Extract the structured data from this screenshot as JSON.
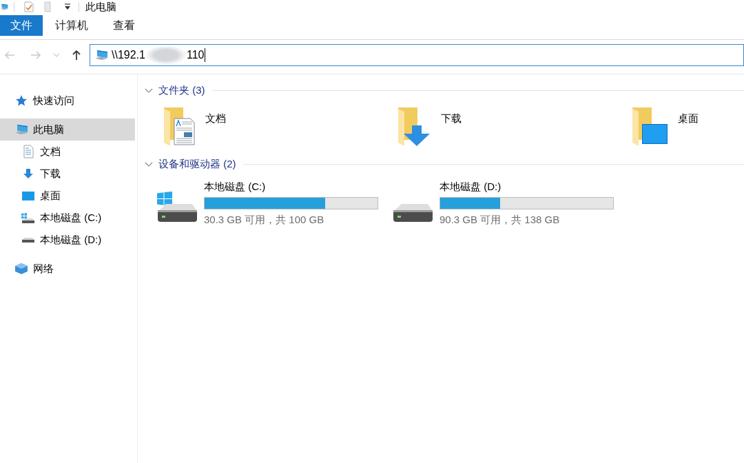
{
  "window": {
    "title": "此电脑"
  },
  "ribbon_tabs": [
    {
      "label": "文件",
      "kind": "file",
      "selected": false
    },
    {
      "label": "计算机",
      "kind": "tab",
      "selected": false
    },
    {
      "label": "查看",
      "kind": "tab",
      "selected": false
    }
  ],
  "nav_buttons": [
    {
      "kind": "back",
      "disabled": true
    },
    {
      "kind": "forward",
      "disabled": true
    },
    {
      "kind": "recent",
      "disabled": true
    },
    {
      "kind": "up",
      "disabled": false
    }
  ],
  "address": {
    "value_start": "\\\\192.1",
    "value_end": "110",
    "redacted": true,
    "focused": true
  },
  "sidebar": {
    "items": [
      {
        "label": "快速访问",
        "kind": "quick-access",
        "selected": false
      },
      {
        "label": "此电脑",
        "kind": "computer",
        "selected": true,
        "children": [
          {
            "label": "文档",
            "kind": "documents",
            "selected": false
          },
          {
            "label": "下载",
            "kind": "downloads",
            "selected": false
          },
          {
            "label": "桌面",
            "kind": "desktop",
            "selected": false
          },
          {
            "label": "本地磁盘 (C:)",
            "kind": "system-drive",
            "selected": false
          },
          {
            "label": "本地磁盘 (D:)",
            "kind": "drive",
            "selected": false
          }
        ]
      },
      {
        "label": "网络",
        "kind": "network",
        "selected": false
      }
    ]
  },
  "sections": [
    {
      "title": "文件夹 (3)",
      "kind": "folders",
      "expanded": true,
      "items": [
        {
          "name": "文档",
          "kind": "documents"
        },
        {
          "name": "下载",
          "kind": "downloads"
        },
        {
          "name": "桌面",
          "kind": "desktop"
        }
      ]
    },
    {
      "title": "设备和驱动器 (2)",
      "kind": "drives",
      "expanded": true,
      "items": [
        {
          "name": "本地磁盘 (C:)",
          "kind": "system",
          "level": 0.697,
          "free_text": "30.3 GB 可用，共 100 GB"
        },
        {
          "name": "本地磁盘 (D:)",
          "kind": "data",
          "level": 0.346,
          "free_text": "90.3 GB 可用，共 138 GB"
        }
      ]
    }
  ]
}
